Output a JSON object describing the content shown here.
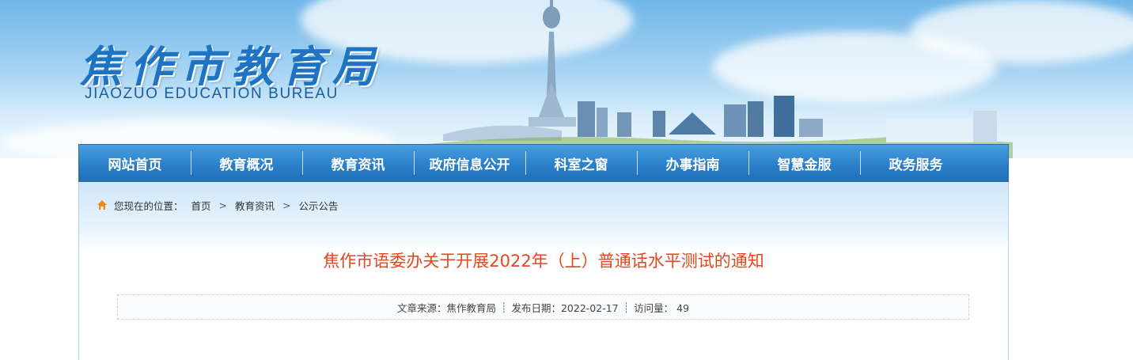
{
  "header": {
    "site_name_cn": "焦作市教育局",
    "site_name_en": "JIAOZUO EDUCATION BUREAU"
  },
  "nav": {
    "items": [
      {
        "label": "网站首页"
      },
      {
        "label": "教育概况"
      },
      {
        "label": "教育资讯"
      },
      {
        "label": "政府信息公开"
      },
      {
        "label": "科室之窗"
      },
      {
        "label": "办事指南"
      },
      {
        "label": "智慧金服"
      },
      {
        "label": "政务服务"
      }
    ]
  },
  "breadcrumb": {
    "icon": "home-icon",
    "prefix": "您现在的位置：",
    "items": [
      "首页",
      "教育资讯",
      "公示公告"
    ],
    "separator": ">"
  },
  "article": {
    "title": "焦作市语委办关于开展2022年（上）普通话水平测试的通知",
    "source": "文章来源：焦作教育局",
    "date": "发布日期：2022-02-17",
    "visits": "访问量： 49"
  },
  "colors": {
    "nav_bg": "#2a80c9",
    "title": "#e4461e",
    "logo": "#1e73c3"
  }
}
